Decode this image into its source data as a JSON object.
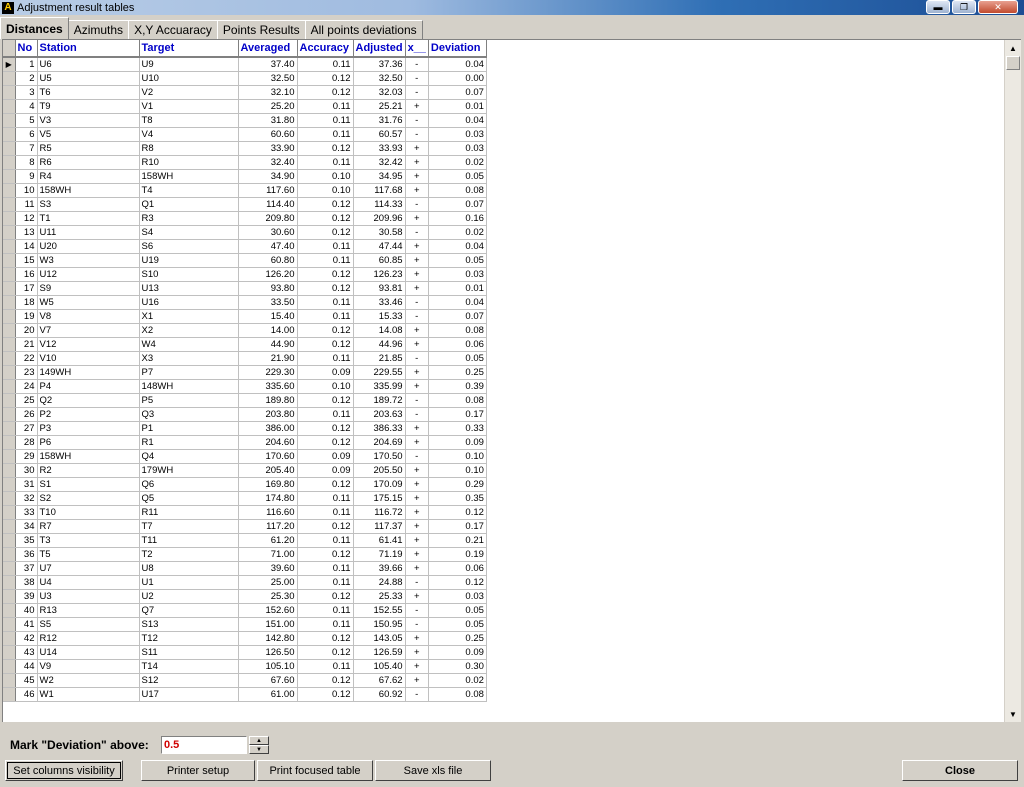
{
  "window": {
    "title": "Adjustment result tables",
    "icon_letter": "A"
  },
  "tabs": [
    "Distances",
    "Azimuths",
    "X,Y Accuaracy",
    "Points Results",
    "All points deviations"
  ],
  "table": {
    "columns": [
      "No",
      "Station",
      "Target",
      "Averaged",
      "Accuracy",
      "Adjusted",
      "x__",
      "Deviation"
    ],
    "rows": [
      [
        "1",
        "U6",
        "U9",
        "37.40",
        "0.11",
        "37.36",
        "-",
        "0.04"
      ],
      [
        "2",
        "U5",
        "U10",
        "32.50",
        "0.12",
        "32.50",
        "-",
        "0.00"
      ],
      [
        "3",
        "T6",
        "V2",
        "32.10",
        "0.12",
        "32.03",
        "-",
        "0.07"
      ],
      [
        "4",
        "T9",
        "V1",
        "25.20",
        "0.11",
        "25.21",
        "+",
        "0.01"
      ],
      [
        "5",
        "V3",
        "T8",
        "31.80",
        "0.11",
        "31.76",
        "-",
        "0.04"
      ],
      [
        "6",
        "V5",
        "V4",
        "60.60",
        "0.11",
        "60.57",
        "-",
        "0.03"
      ],
      [
        "7",
        "R5",
        "R8",
        "33.90",
        "0.12",
        "33.93",
        "+",
        "0.03"
      ],
      [
        "8",
        "R6",
        "R10",
        "32.40",
        "0.11",
        "32.42",
        "+",
        "0.02"
      ],
      [
        "9",
        "R4",
        "158WH",
        "34.90",
        "0.10",
        "34.95",
        "+",
        "0.05"
      ],
      [
        "10",
        "158WH",
        "T4",
        "117.60",
        "0.10",
        "117.68",
        "+",
        "0.08"
      ],
      [
        "11",
        "S3",
        "Q1",
        "114.40",
        "0.12",
        "114.33",
        "-",
        "0.07"
      ],
      [
        "12",
        "T1",
        "R3",
        "209.80",
        "0.12",
        "209.96",
        "+",
        "0.16"
      ],
      [
        "13",
        "U11",
        "S4",
        "30.60",
        "0.12",
        "30.58",
        "-",
        "0.02"
      ],
      [
        "14",
        "U20",
        "S6",
        "47.40",
        "0.11",
        "47.44",
        "+",
        "0.04"
      ],
      [
        "15",
        "W3",
        "U19",
        "60.80",
        "0.11",
        "60.85",
        "+",
        "0.05"
      ],
      [
        "16",
        "U12",
        "S10",
        "126.20",
        "0.12",
        "126.23",
        "+",
        "0.03"
      ],
      [
        "17",
        "S9",
        "U13",
        "93.80",
        "0.12",
        "93.81",
        "+",
        "0.01"
      ],
      [
        "18",
        "W5",
        "U16",
        "33.50",
        "0.11",
        "33.46",
        "-",
        "0.04"
      ],
      [
        "19",
        "V8",
        "X1",
        "15.40",
        "0.11",
        "15.33",
        "-",
        "0.07"
      ],
      [
        "20",
        "V7",
        "X2",
        "14.00",
        "0.12",
        "14.08",
        "+",
        "0.08"
      ],
      [
        "21",
        "V12",
        "W4",
        "44.90",
        "0.12",
        "44.96",
        "+",
        "0.06"
      ],
      [
        "22",
        "V10",
        "X3",
        "21.90",
        "0.11",
        "21.85",
        "-",
        "0.05"
      ],
      [
        "23",
        "149WH",
        "P7",
        "229.30",
        "0.09",
        "229.55",
        "+",
        "0.25"
      ],
      [
        "24",
        "P4",
        "148WH",
        "335.60",
        "0.10",
        "335.99",
        "+",
        "0.39"
      ],
      [
        "25",
        "Q2",
        "P5",
        "189.80",
        "0.12",
        "189.72",
        "-",
        "0.08"
      ],
      [
        "26",
        "P2",
        "Q3",
        "203.80",
        "0.11",
        "203.63",
        "-",
        "0.17"
      ],
      [
        "27",
        "P3",
        "P1",
        "386.00",
        "0.12",
        "386.33",
        "+",
        "0.33"
      ],
      [
        "28",
        "P6",
        "R1",
        "204.60",
        "0.12",
        "204.69",
        "+",
        "0.09"
      ],
      [
        "29",
        "158WH",
        "Q4",
        "170.60",
        "0.09",
        "170.50",
        "-",
        "0.10"
      ],
      [
        "30",
        "R2",
        "179WH",
        "205.40",
        "0.09",
        "205.50",
        "+",
        "0.10"
      ],
      [
        "31",
        "S1",
        "Q6",
        "169.80",
        "0.12",
        "170.09",
        "+",
        "0.29"
      ],
      [
        "32",
        "S2",
        "Q5",
        "174.80",
        "0.11",
        "175.15",
        "+",
        "0.35"
      ],
      [
        "33",
        "T10",
        "R11",
        "116.60",
        "0.11",
        "116.72",
        "+",
        "0.12"
      ],
      [
        "34",
        "R7",
        "T7",
        "117.20",
        "0.12",
        "117.37",
        "+",
        "0.17"
      ],
      [
        "35",
        "T3",
        "T11",
        "61.20",
        "0.11",
        "61.41",
        "+",
        "0.21"
      ],
      [
        "36",
        "T5",
        "T2",
        "71.00",
        "0.12",
        "71.19",
        "+",
        "0.19"
      ],
      [
        "37",
        "U7",
        "U8",
        "39.60",
        "0.11",
        "39.66",
        "+",
        "0.06"
      ],
      [
        "38",
        "U4",
        "U1",
        "25.00",
        "0.11",
        "24.88",
        "-",
        "0.12"
      ],
      [
        "39",
        "U3",
        "U2",
        "25.30",
        "0.12",
        "25.33",
        "+",
        "0.03"
      ],
      [
        "40",
        "R13",
        "Q7",
        "152.60",
        "0.11",
        "152.55",
        "-",
        "0.05"
      ],
      [
        "41",
        "S5",
        "S13",
        "151.00",
        "0.11",
        "150.95",
        "-",
        "0.05"
      ],
      [
        "42",
        "R12",
        "T12",
        "142.80",
        "0.12",
        "143.05",
        "+",
        "0.25"
      ],
      [
        "43",
        "U14",
        "S11",
        "126.50",
        "0.12",
        "126.59",
        "+",
        "0.09"
      ],
      [
        "44",
        "V9",
        "T14",
        "105.10",
        "0.11",
        "105.40",
        "+",
        "0.30"
      ],
      [
        "45",
        "W2",
        "S12",
        "67.60",
        "0.12",
        "67.62",
        "+",
        "0.02"
      ],
      [
        "46",
        "W1",
        "U17",
        "61.00",
        "0.12",
        "60.92",
        "-",
        "0.08"
      ]
    ]
  },
  "mark": {
    "label": "Mark \"Deviation\" above:",
    "value": "0.5"
  },
  "buttons": {
    "columns_visibility": "Set columns visibility",
    "printer_setup": "Printer setup",
    "print_focused": "Print focused table",
    "save_xls": "Save xls file",
    "close": "Close"
  },
  "colors": {
    "header_text": "#0000c8",
    "mark_value": "#d00000",
    "face": "#d4d0c8"
  }
}
